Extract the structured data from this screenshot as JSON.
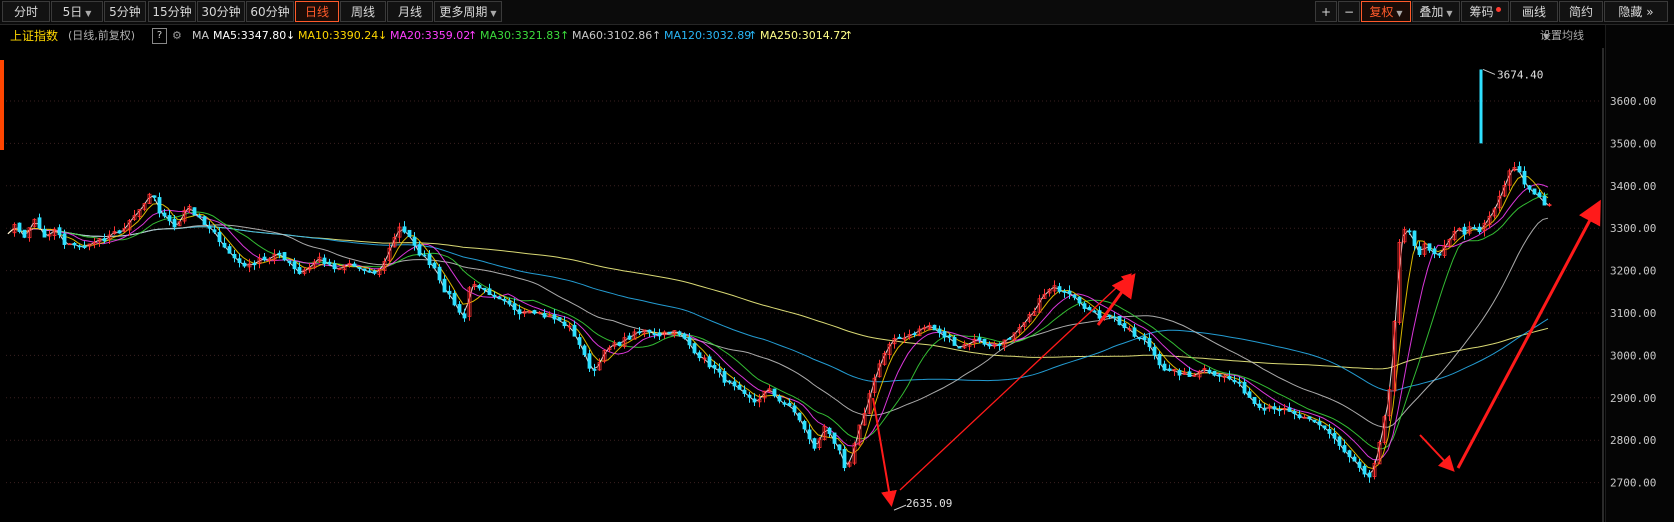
{
  "toolbar": {
    "periods": [
      "分时",
      "5日",
      "5分钟",
      "15分钟",
      "30分钟",
      "60分钟",
      "日线",
      "周线",
      "月线",
      "更多周期"
    ],
    "active_period": "日线",
    "right": {
      "plus": "+",
      "minus": "−",
      "fuquan": "复权",
      "diejia": "叠加",
      "chouma": "筹码",
      "huaxian": "画线",
      "jianyue": "简约",
      "yincang": "隐藏",
      "expand": "»"
    }
  },
  "ma_bar": {
    "index_name": "上证指数",
    "mode": "(日线,前复权)",
    "help": "?",
    "ma_label": "MA",
    "items": [
      {
        "text": "MA5:3347.80",
        "arrow": "↓",
        "color": "#ffffff"
      },
      {
        "text": "MA10:3390.24",
        "arrow": "↓",
        "color": "#ffd700"
      },
      {
        "text": "MA20:3359.02",
        "arrow": "↑",
        "color": "#ff40ff"
      },
      {
        "text": "MA30:3321.83",
        "arrow": "↑",
        "color": "#3cdc3c"
      },
      {
        "text": "MA60:3102.86",
        "arrow": "↑",
        "color": "#c8c8c8"
      },
      {
        "text": "MA120:3032.89",
        "arrow": "↑",
        "color": "#29b6f6"
      },
      {
        "text": "MA250:3014.72",
        "arrow": "↑",
        "color": "#ffff88"
      }
    ],
    "settings": "设置均线"
  },
  "y_axis": {
    "ticks": [
      "3600.00",
      "3500.00",
      "3400.00",
      "3300.00",
      "3200.00",
      "3100.00",
      "3000.00",
      "2900.00",
      "2800.00",
      "2700.00"
    ]
  },
  "chart_data": {
    "type": "candlestick",
    "y_range": [
      2635,
      3700
    ],
    "annotations": [
      {
        "label": "3674.40",
        "value": 3674.4
      },
      {
        "label": "2635.09",
        "value": 2635.09
      }
    ],
    "ma_colors": {
      "MA5": "#ffffff",
      "MA10": "#ffd700",
      "MA20": "#ff40ff",
      "MA30": "#3cdc3c",
      "MA60": "#c8c8c8",
      "MA120": "#29b6f6",
      "MA250": "#ffff88"
    },
    "up_color": "#ff3333",
    "down_color": "#2fe0ff",
    "arrow_color": "#ff1a1a",
    "close_path": [
      [
        0,
        3290
      ],
      [
        8,
        3305
      ],
      [
        18,
        3280
      ],
      [
        28,
        3325
      ],
      [
        38,
        3270
      ],
      [
        48,
        3300
      ],
      [
        58,
        3255
      ],
      [
        68,
        3265
      ],
      [
        78,
        3250
      ],
      [
        88,
        3275
      ],
      [
        98,
        3270
      ],
      [
        108,
        3290
      ],
      [
        118,
        3300
      ],
      [
        128,
        3330
      ],
      [
        138,
        3360
      ],
      [
        145,
        3385
      ],
      [
        150,
        3340
      ],
      [
        158,
        3330
      ],
      [
        165,
        3300
      ],
      [
        172,
        3320
      ],
      [
        180,
        3360
      ],
      [
        188,
        3330
      ],
      [
        196,
        3310
      ],
      [
        205,
        3290
      ],
      [
        214,
        3270
      ],
      [
        222,
        3240
      ],
      [
        232,
        3220
      ],
      [
        242,
        3210
      ],
      [
        252,
        3230
      ],
      [
        262,
        3225
      ],
      [
        272,
        3240
      ],
      [
        282,
        3220
      ],
      [
        292,
        3195
      ],
      [
        302,
        3210
      ],
      [
        312,
        3230
      ],
      [
        322,
        3210
      ],
      [
        332,
        3200
      ],
      [
        342,
        3215
      ],
      [
        352,
        3205
      ],
      [
        362,
        3190
      ],
      [
        372,
        3200
      ],
      [
        380,
        3240
      ],
      [
        386,
        3275
      ],
      [
        392,
        3305
      ],
      [
        400,
        3285
      ],
      [
        408,
        3250
      ],
      [
        418,
        3230
      ],
      [
        428,
        3205
      ],
      [
        438,
        3150
      ],
      [
        448,
        3120
      ],
      [
        456,
        3080
      ],
      [
        462,
        3160
      ],
      [
        470,
        3170
      ],
      [
        480,
        3140
      ],
      [
        490,
        3130
      ],
      [
        500,
        3120
      ],
      [
        512,
        3105
      ],
      [
        524,
        3110
      ],
      [
        536,
        3095
      ],
      [
        548,
        3085
      ],
      [
        560,
        3070
      ],
      [
        570,
        3040
      ],
      [
        578,
        2990
      ],
      [
        586,
        2960
      ],
      [
        594,
        3000
      ],
      [
        604,
        3020
      ],
      [
        616,
        3035
      ],
      [
        628,
        3050
      ],
      [
        640,
        3060
      ],
      [
        652,
        3050
      ],
      [
        664,
        3060
      ],
      [
        676,
        3040
      ],
      [
        686,
        3015
      ],
      [
        696,
        2990
      ],
      [
        706,
        2970
      ],
      [
        716,
        2945
      ],
      [
        726,
        2925
      ],
      [
        736,
        2905
      ],
      [
        748,
        2890
      ],
      [
        760,
        2920
      ],
      [
        770,
        2900
      ],
      [
        780,
        2880
      ],
      [
        790,
        2860
      ],
      [
        798,
        2820
      ],
      [
        806,
        2780
      ],
      [
        812,
        2800
      ],
      [
        818,
        2840
      ],
      [
        826,
        2800
      ],
      [
        832,
        2770
      ],
      [
        838,
        2720
      ],
      [
        844,
        2760
      ],
      [
        852,
        2830
      ],
      [
        860,
        2890
      ],
      [
        868,
        2960
      ],
      [
        876,
        3000
      ],
      [
        884,
        3030
      ],
      [
        892,
        3040
      ],
      [
        902,
        3050
      ],
      [
        912,
        3060
      ],
      [
        922,
        3070
      ],
      [
        932,
        3050
      ],
      [
        942,
        3040
      ],
      [
        952,
        3020
      ],
      [
        962,
        3030
      ],
      [
        972,
        3040
      ],
      [
        982,
        3020
      ],
      [
        992,
        3030
      ],
      [
        1002,
        3035
      ],
      [
        1012,
        3060
      ],
      [
        1022,
        3090
      ],
      [
        1032,
        3130
      ],
      [
        1040,
        3150
      ],
      [
        1048,
        3160
      ],
      [
        1056,
        3155
      ],
      [
        1064,
        3150
      ],
      [
        1072,
        3130
      ],
      [
        1080,
        3110
      ],
      [
        1090,
        3090
      ],
      [
        1100,
        3100
      ],
      [
        1110,
        3080
      ],
      [
        1120,
        3060
      ],
      [
        1130,
        3040
      ],
      [
        1140,
        3030
      ],
      [
        1150,
        2990
      ],
      [
        1160,
        2960
      ],
      [
        1170,
        2960
      ],
      [
        1182,
        2950
      ],
      [
        1194,
        2970
      ],
      [
        1206,
        2960
      ],
      [
        1216,
        2950
      ],
      [
        1226,
        2940
      ],
      [
        1236,
        2920
      ],
      [
        1246,
        2890
      ],
      [
        1256,
        2880
      ],
      [
        1266,
        2880
      ],
      [
        1276,
        2870
      ],
      [
        1286,
        2860
      ],
      [
        1296,
        2850
      ],
      [
        1306,
        2840
      ],
      [
        1316,
        2830
      ],
      [
        1326,
        2810
      ],
      [
        1334,
        2780
      ],
      [
        1342,
        2760
      ],
      [
        1350,
        2740
      ],
      [
        1356,
        2720
      ],
      [
        1362,
        2710
      ],
      [
        1366,
        2730
      ],
      [
        1372,
        2790
      ],
      [
        1378,
        2860
      ],
      [
        1382,
        2920
      ],
      [
        1386,
        3040
      ],
      [
        1390,
        3200
      ],
      [
        1394,
        3320
      ],
      [
        1398,
        3280
      ],
      [
        1404,
        3300
      ],
      [
        1410,
        3230
      ],
      [
        1416,
        3260
      ],
      [
        1424,
        3240
      ],
      [
        1432,
        3230
      ],
      [
        1440,
        3270
      ],
      [
        1448,
        3300
      ],
      [
        1456,
        3290
      ],
      [
        1464,
        3300
      ],
      [
        1472,
        3290
      ],
      [
        1480,
        3320
      ],
      [
        1488,
        3350
      ],
      [
        1494,
        3380
      ],
      [
        1500,
        3420
      ],
      [
        1506,
        3450
      ],
      [
        1512,
        3430
      ],
      [
        1518,
        3400
      ],
      [
        1524,
        3390
      ],
      [
        1530,
        3380
      ],
      [
        1536,
        3360
      ],
      [
        1542,
        3350
      ],
      [
        1548,
        3345
      ]
    ]
  }
}
